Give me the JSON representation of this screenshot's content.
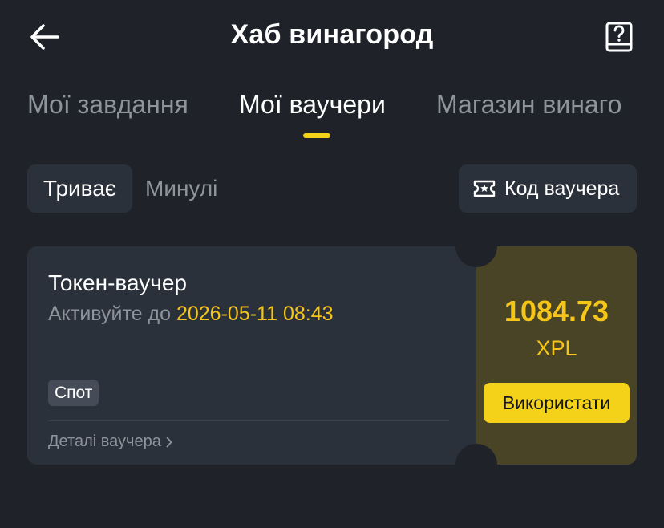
{
  "header": {
    "title": "Хаб винагород",
    "back_icon": "arrow-left-icon",
    "help_icon": "help-book-icon"
  },
  "tabs": [
    {
      "label": "Мої завдання",
      "active": false
    },
    {
      "label": "Мої ваучери",
      "active": true
    },
    {
      "label": "Магазин винаго",
      "active": false
    }
  ],
  "filters": {
    "ongoing": "Триває",
    "past": "Минулі",
    "code_button": "Код ваучера",
    "code_icon": "ticket-star-icon"
  },
  "voucher": {
    "title": "Токен-ваучер",
    "expiry_prefix": "Активуйте до",
    "expiry_date": "2026-05-11 08:43",
    "badge": "Спот",
    "details_link": "Деталі ваучера",
    "amount": "1084.73",
    "currency": "XPL",
    "use_button": "Використати"
  },
  "colors": {
    "background": "#1f2329",
    "accent": "#f5d21a",
    "highlight_text": "#f5c518",
    "card": "#2b313b",
    "card_value_panel": "#4a4426"
  }
}
